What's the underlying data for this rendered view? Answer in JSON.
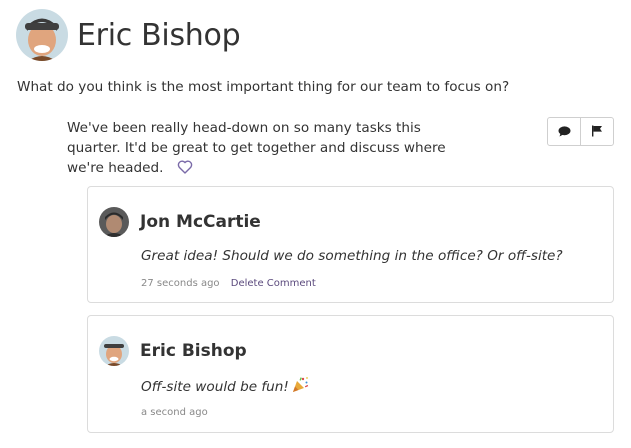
{
  "post": {
    "author": "Eric Bishop",
    "question": "What do you think is the most important thing for our team to focus on?",
    "answer": "We've been really head-down on so many tasks this quarter. It'd be great to get together and discuss where we're headed."
  },
  "comments": [
    {
      "author": "Jon McCartie",
      "text": "Great idea! Should we do something in the office? Or off-site?",
      "time": "27 seconds ago",
      "delete_label": "Delete Comment"
    },
    {
      "author": "Eric Bishop",
      "text": "Off-site would be fun!",
      "time": "a second ago"
    }
  ],
  "icons": {
    "comment": "comment-icon",
    "flag": "flag-icon",
    "like": "heart-icon",
    "emoji": "party-popper-icon"
  },
  "colors": {
    "link": "#5b4a7d",
    "heart": "#7a6aa8"
  }
}
